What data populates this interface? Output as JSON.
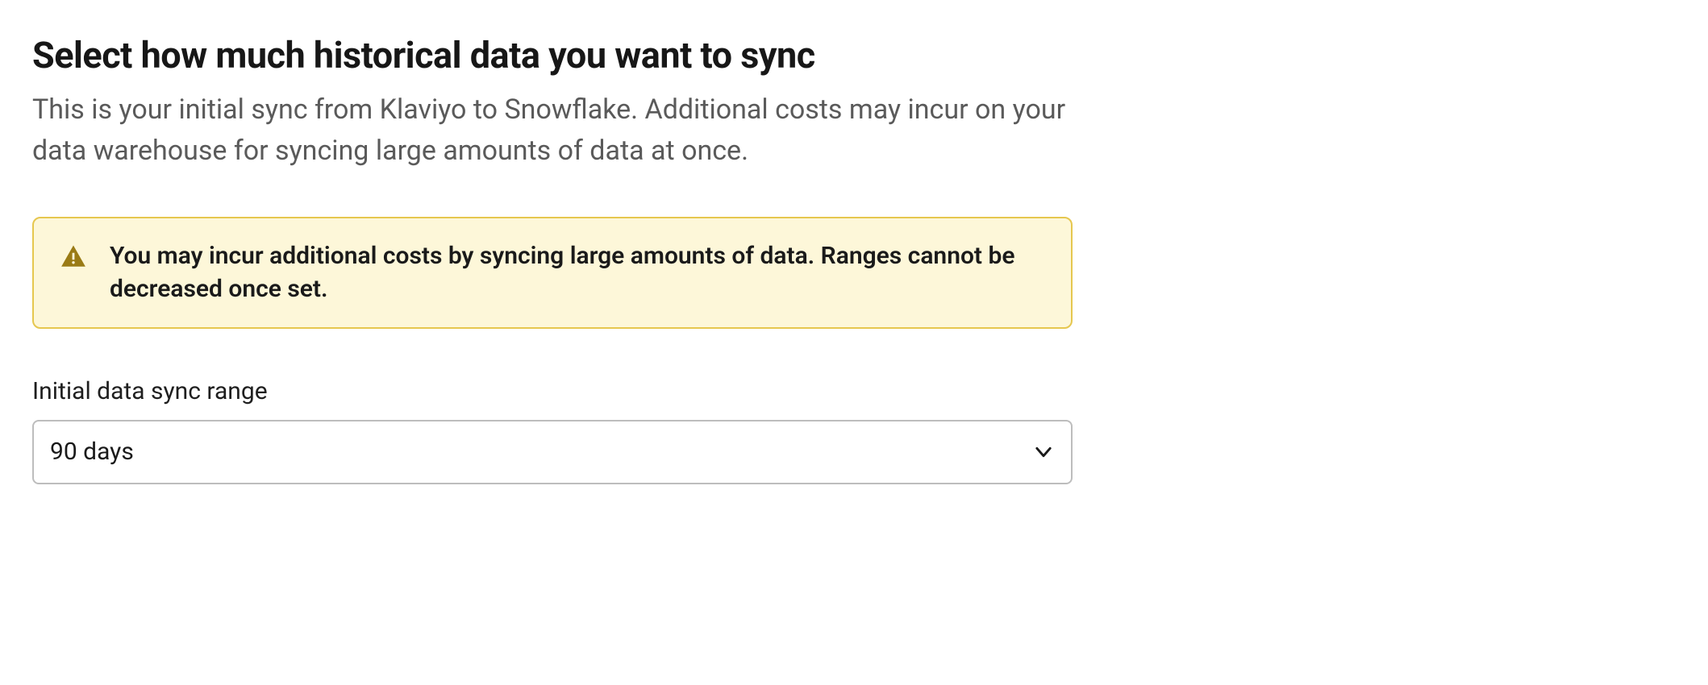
{
  "heading": "Select how much historical data you want to sync",
  "description": "This is your initial sync from Klaviyo to Snowflake. Additional costs may incur on your data warehouse for syncing large amounts of data at once.",
  "alert": {
    "text": "You may incur additional costs by syncing large amounts of data. Ranges cannot be decreased once set."
  },
  "field": {
    "label": "Initial data sync range",
    "value": "90 days"
  },
  "colors": {
    "alert_bg": "#fdf7d9",
    "alert_border": "#e6c74f",
    "alert_icon": "#9a7b15"
  }
}
